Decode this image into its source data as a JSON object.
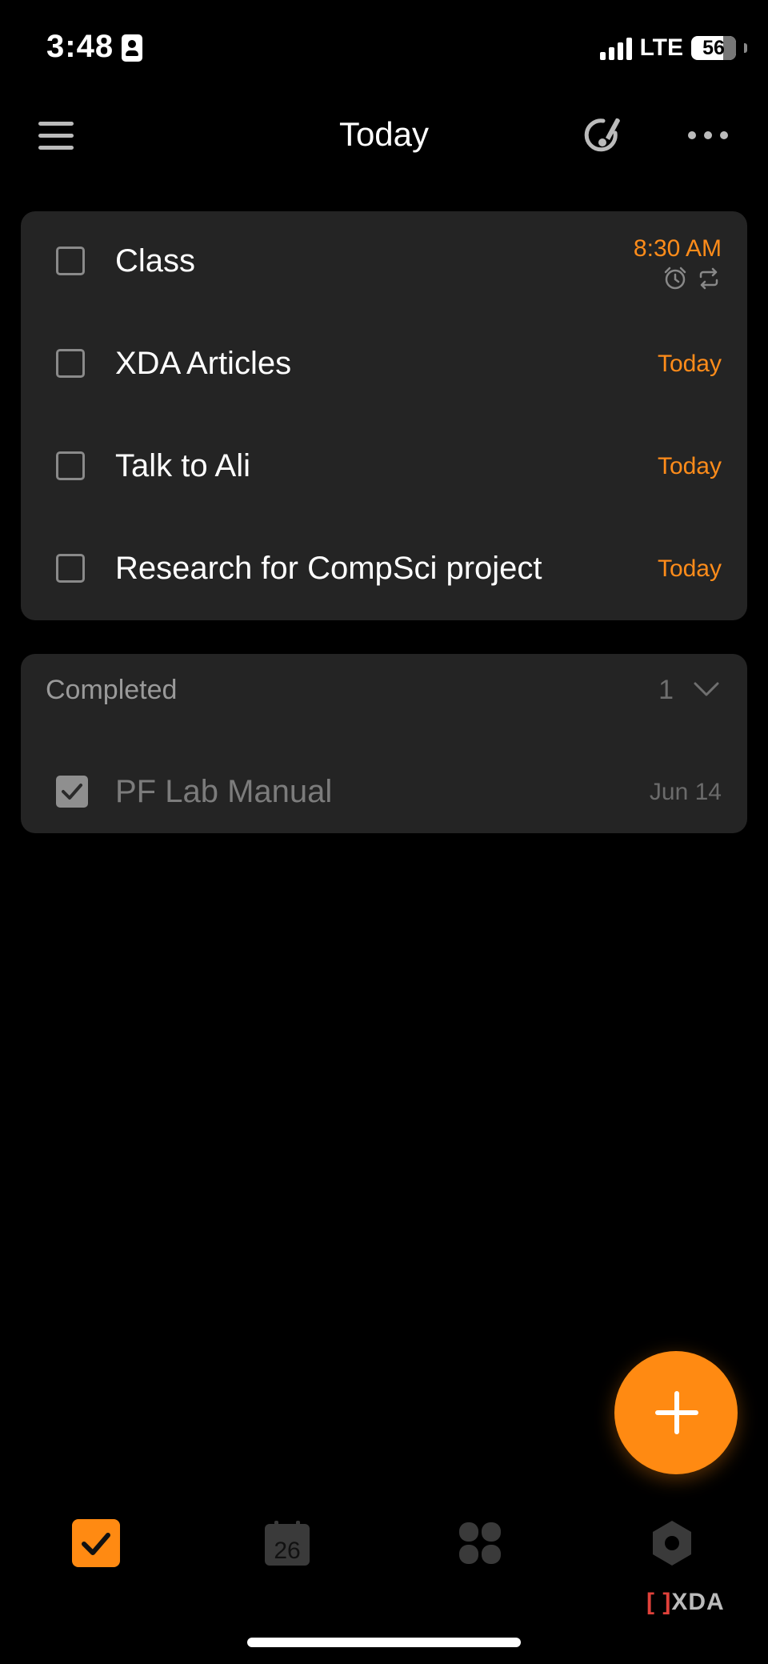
{
  "status": {
    "time": "3:48",
    "network": "LTE",
    "battery": "56"
  },
  "header": {
    "title": "Today"
  },
  "tasks": [
    {
      "title": "Class",
      "date": "8:30 AM"
    },
    {
      "title": "XDA Articles",
      "date": "Today"
    },
    {
      "title": "Talk to Ali",
      "date": "Today"
    },
    {
      "title": "Research for CompSci project",
      "date": "Today"
    }
  ],
  "completed": {
    "label": "Completed",
    "count": "1",
    "items": [
      {
        "title": "PF Lab Manual",
        "date": "Jun 14"
      }
    ]
  },
  "tabbar": {
    "calendar_day": "26"
  },
  "watermark": {
    "text": "XDA"
  },
  "colors": {
    "accent": "#ff8a12",
    "card": "#242424",
    "background": "#000000"
  },
  "icons": [
    "menu-icon",
    "theme-icon",
    "more-icon",
    "alarm-icon",
    "repeat-icon",
    "chevron-down-icon",
    "plus-icon",
    "checkbox-icon",
    "calendar-icon",
    "grid-icon",
    "focus-icon"
  ]
}
